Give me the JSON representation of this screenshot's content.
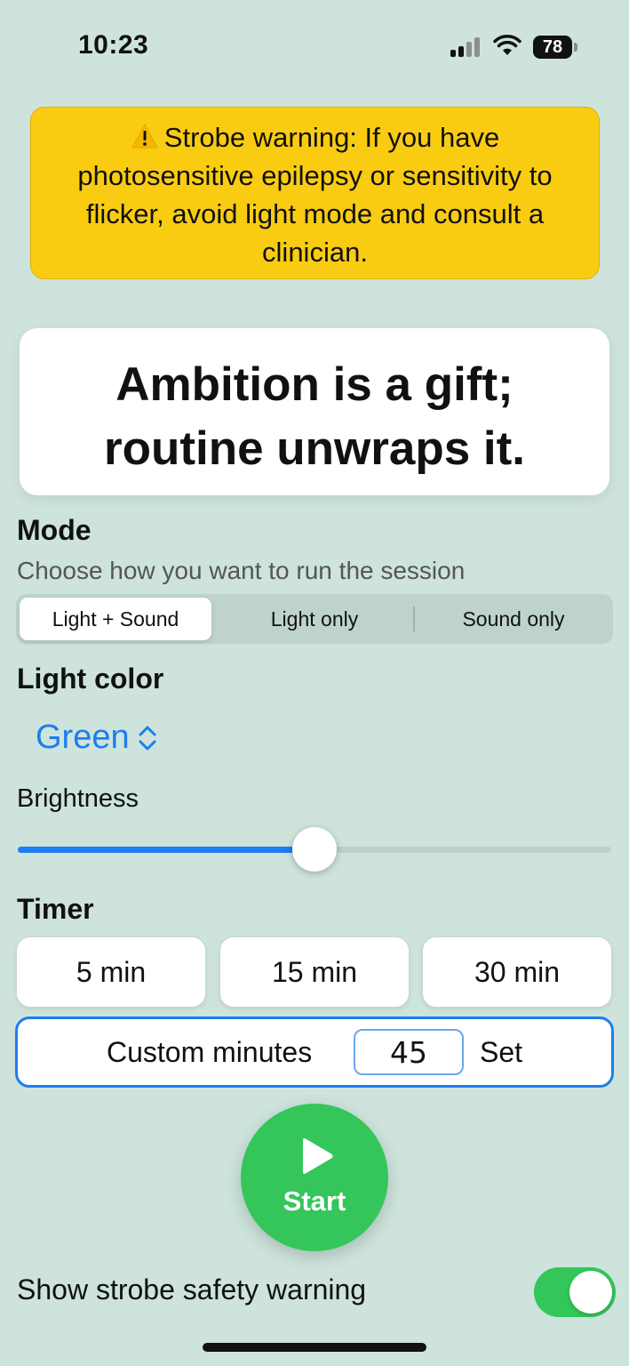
{
  "status_bar": {
    "time": "10:23",
    "battery": "78",
    "signal_icon": "cellular-signal-icon",
    "wifi_icon": "wifi-icon"
  },
  "warning": {
    "icon": "warning-triangle-icon",
    "text": "Strobe warning: If you have photosensitive epilepsy or sensitivity to flicker, avoid light mode and consult a clinician.",
    "background": "#f9cc12"
  },
  "quote": {
    "line1": "Ambition is a gift;",
    "line2": "routine unwraps it."
  },
  "mode": {
    "title": "Mode",
    "subtitle": "Choose how you want to run the session",
    "options": [
      "Light + Sound",
      "Light only",
      "Sound only"
    ],
    "selected": "Light + Sound"
  },
  "light_color": {
    "title": "Light color",
    "value": "Green",
    "accent": "#1c7ef0"
  },
  "brightness": {
    "label": "Brightness",
    "level": 0.5
  },
  "timer": {
    "title": "Timer",
    "presets": [
      "5 min",
      "15 min",
      "30 min"
    ],
    "custom_label": "Custom minutes",
    "custom_value": "45",
    "set_label": "Set"
  },
  "start": {
    "label": "Start",
    "color": "#34c65a"
  },
  "safety_toggle": {
    "label": "Show strobe safety warning",
    "on": true
  }
}
